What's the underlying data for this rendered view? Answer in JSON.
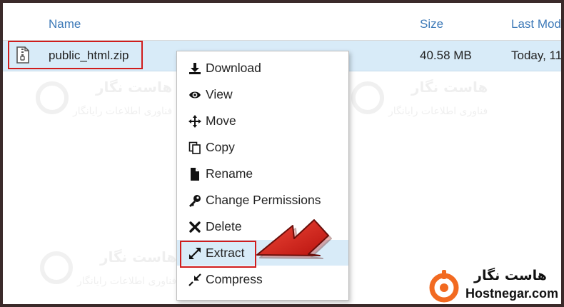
{
  "table": {
    "columns": [
      "Name",
      "Size",
      "Last Modi"
    ],
    "rows": [
      {
        "name": "public_html.zip",
        "size": "40.58 MB",
        "modified": "Today, 11"
      }
    ]
  },
  "context_menu": {
    "items": [
      {
        "label": "Download",
        "icon": "download-icon"
      },
      {
        "label": "View",
        "icon": "eye-icon"
      },
      {
        "label": "Move",
        "icon": "move-icon"
      },
      {
        "label": "Copy",
        "icon": "copy-icon"
      },
      {
        "label": "Rename",
        "icon": "file-icon"
      },
      {
        "label": "Change Permissions",
        "icon": "key-icon"
      },
      {
        "label": "Delete",
        "icon": "close-icon"
      },
      {
        "label": "Extract",
        "icon": "expand-icon"
      },
      {
        "label": "Compress",
        "icon": "compress-icon"
      }
    ],
    "highlighted": "Extract"
  },
  "watermark": {
    "title": "هاست نگار",
    "subtitle": "فناوری اطلاعات رایانگار"
  },
  "brand": {
    "name_fa": "هاست نگار",
    "name_en": "Hostnegar.com"
  },
  "colors": {
    "header_text": "#3e7ab8",
    "row_highlight": "#d8ebf8",
    "annotation_red": "#d01c1c",
    "brand_orange": "#f26a21"
  }
}
